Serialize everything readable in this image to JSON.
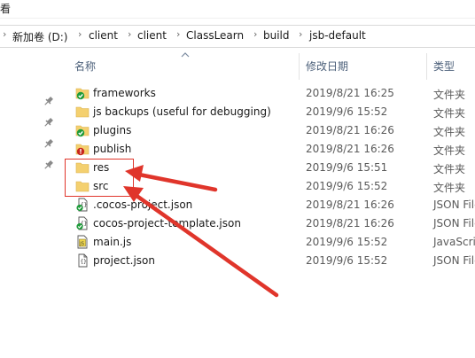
{
  "window": {
    "title_fragment": "看"
  },
  "breadcrumb": {
    "items": [
      {
        "label": "新加卷 (D:)"
      },
      {
        "label": "client"
      },
      {
        "label": "client"
      },
      {
        "label": "ClassLearn"
      },
      {
        "label": "build"
      },
      {
        "label": "jsb-default"
      }
    ]
  },
  "columns": {
    "name": "名称",
    "modified": "修改日期",
    "type": "类型"
  },
  "files": [
    {
      "name": "frameworks",
      "modified": "2019/8/21 16:25",
      "type": "文件夹",
      "icon": "folder-sync-ok-icon"
    },
    {
      "name": "js backups (useful for debugging)",
      "modified": "2019/9/6 15:52",
      "type": "文件夹",
      "icon": "folder-icon"
    },
    {
      "name": "plugins",
      "modified": "2019/8/21 16:26",
      "type": "文件夹",
      "icon": "folder-sync-ok-icon"
    },
    {
      "name": "publish",
      "modified": "2019/8/21 16:26",
      "type": "文件夹",
      "icon": "folder-sync-error-icon"
    },
    {
      "name": "res",
      "modified": "2019/9/6 15:51",
      "type": "文件夹",
      "icon": "folder-icon"
    },
    {
      "name": "src",
      "modified": "2019/9/6 15:52",
      "type": "文件夹",
      "icon": "folder-icon"
    },
    {
      "name": ".cocos-project.json",
      "modified": "2019/8/21 16:26",
      "type": "JSON File",
      "icon": "json-file-sync-ok-icon"
    },
    {
      "name": "cocos-project-template.json",
      "modified": "2019/8/21 16:26",
      "type": "JSON File",
      "icon": "json-file-sync-ok-icon"
    },
    {
      "name": "main.js",
      "modified": "2019/9/6 15:52",
      "type": "JavaScript",
      "icon": "js-file-icon"
    },
    {
      "name": "project.json",
      "modified": "2019/9/6 15:52",
      "type": "JSON File",
      "icon": "json-file-icon"
    }
  ],
  "annotation": {
    "color": "#e0352b",
    "highlighted": [
      "res",
      "src"
    ]
  },
  "colors": {
    "folder": "#f4d06f",
    "sync_ok": "#1e9b3a",
    "sync_error": "#c8261d",
    "header_text": "#4c607a"
  }
}
